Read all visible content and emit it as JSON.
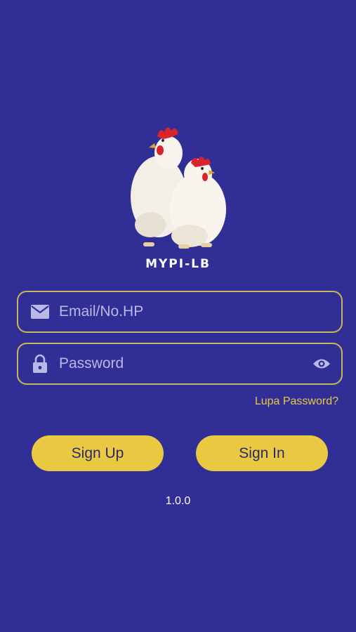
{
  "app": {
    "name": "MYPI-LB",
    "logo_icon": "chicken-logo",
    "version": "1.0.0"
  },
  "form": {
    "email": {
      "placeholder": "Email/No.HP",
      "value": "",
      "icon": "mail-icon"
    },
    "password": {
      "placeholder": "Password",
      "value": "",
      "icon": "lock-icon",
      "toggle_icon": "eye-icon"
    },
    "forgot_password_label": "Lupa Password?"
  },
  "actions": {
    "sign_up_label": "Sign Up",
    "sign_in_label": "Sign In"
  },
  "colors": {
    "background": "#312f96",
    "accent": "#e9c842",
    "field_border": "#c9b65e",
    "link": "#e6c84a"
  }
}
